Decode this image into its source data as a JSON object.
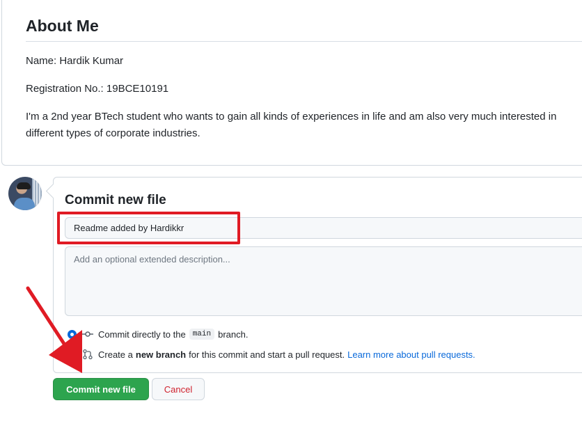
{
  "readme": {
    "title": "About Me",
    "name_line": "Name: Hardik Kumar",
    "registration_line": "Registration No.: 19BCE10191",
    "bio_line1": "I'm a 2nd year BTech student who wants to gain all kinds of experiences in life and am also very much interested in",
    "bio_line2": "different types of corporate industries."
  },
  "commit": {
    "title": "Commit new file",
    "summary_value": "Readme added by Hardikkr",
    "description_placeholder": "Add an optional extended description...",
    "option_direct": {
      "prefix": "Commit directly to the",
      "branch": "main",
      "suffix": "branch.",
      "selected": true
    },
    "option_new_branch": {
      "prefix": "Create a",
      "bold": "new branch",
      "suffix": "for this commit and start a pull request.",
      "link": "Learn more about pull requests.",
      "selected": false
    },
    "commit_button": "Commit new file",
    "cancel_button": "Cancel"
  },
  "colors": {
    "accent": "#0969da",
    "commit_button": "#2da44e",
    "cancel_text": "#cf222e",
    "annotation": "#e01b24"
  },
  "icons": {
    "avatar": "user-avatar",
    "commit": "git-commit-icon",
    "pull_request": "git-pull-request-icon"
  }
}
